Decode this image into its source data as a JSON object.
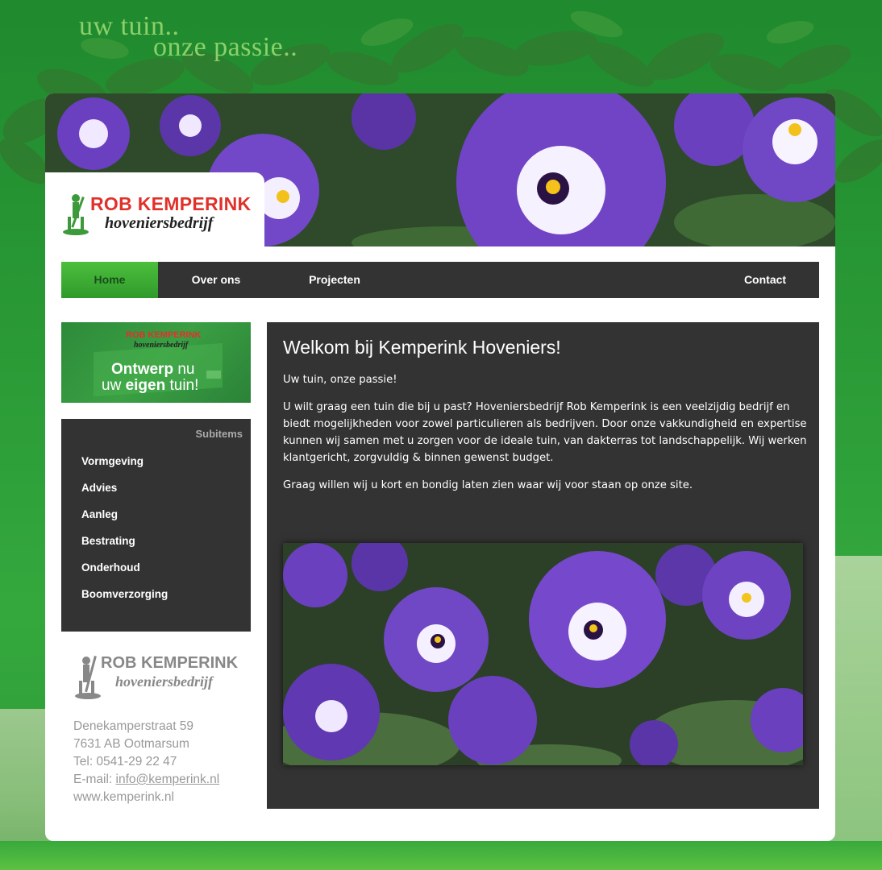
{
  "header": {
    "slogan_line1": "uw tuin..",
    "slogan_line2": "onze passie..",
    "logo_name": "ROB KEMPERINK",
    "logo_sub": "hoveniersbedrijf"
  },
  "nav": {
    "items": [
      {
        "label": "Home",
        "active": true
      },
      {
        "label": "Over ons",
        "active": false
      },
      {
        "label": "Projecten",
        "active": false
      },
      {
        "label": "Contact",
        "active": false
      }
    ]
  },
  "promo": {
    "logo_name": "ROB KEMPERINK",
    "logo_sub": "hoveniersbedrijf",
    "line1_bold": "Ontwerp",
    "line1_rest": "nu",
    "line2_pre": "uw",
    "line2_bold": "eigen",
    "line2_rest": "tuin!"
  },
  "subnav": {
    "title": "Subitems",
    "items": [
      "Vormgeving",
      "Advies",
      "Aanleg",
      "Bestrating",
      "Onderhoud",
      "Boomverzorging"
    ]
  },
  "sidebar_logo": {
    "name": "ROB KEMPERINK",
    "sub": "hoveniersbedrijf"
  },
  "contact": {
    "street": "Denekamperstraat 59",
    "city": "7631 AB Ootmarsum",
    "phone": "Tel: 0541-29 22 47",
    "email_label": "E-mail: ",
    "email": "info@kemperink.nl",
    "website": "www.kemperink.nl"
  },
  "main": {
    "title": "Welkom bij Kemperink Hoveniers!",
    "intro": "Uw tuin, onze passie!",
    "body": "U wilt graag een tuin die bij u past? Hoveniersbedrijf Rob Kemperink is een veelzijdig bedrijf en biedt mogelijkheden voor zowel particulieren als bedrijven.  Door onze vakkundigheid en expertise kunnen wij samen met u zorgen voor de ideale tuin, van dakterras tot landschappelijk. Wij werken klantgericht, zorgvuldig & binnen gewenst budget.",
    "closing": "Graag willen wij u kort en bondig laten zien waar wij voor staan op onze site."
  },
  "colors": {
    "background": "#2a9a36",
    "dark_panel": "#333333",
    "nav_active": "#3fb038",
    "logo_red": "#e0312b",
    "logo_green": "#3d9a3a",
    "pansy_purple": "#6a3fc0",
    "text_grey": "#999999"
  }
}
